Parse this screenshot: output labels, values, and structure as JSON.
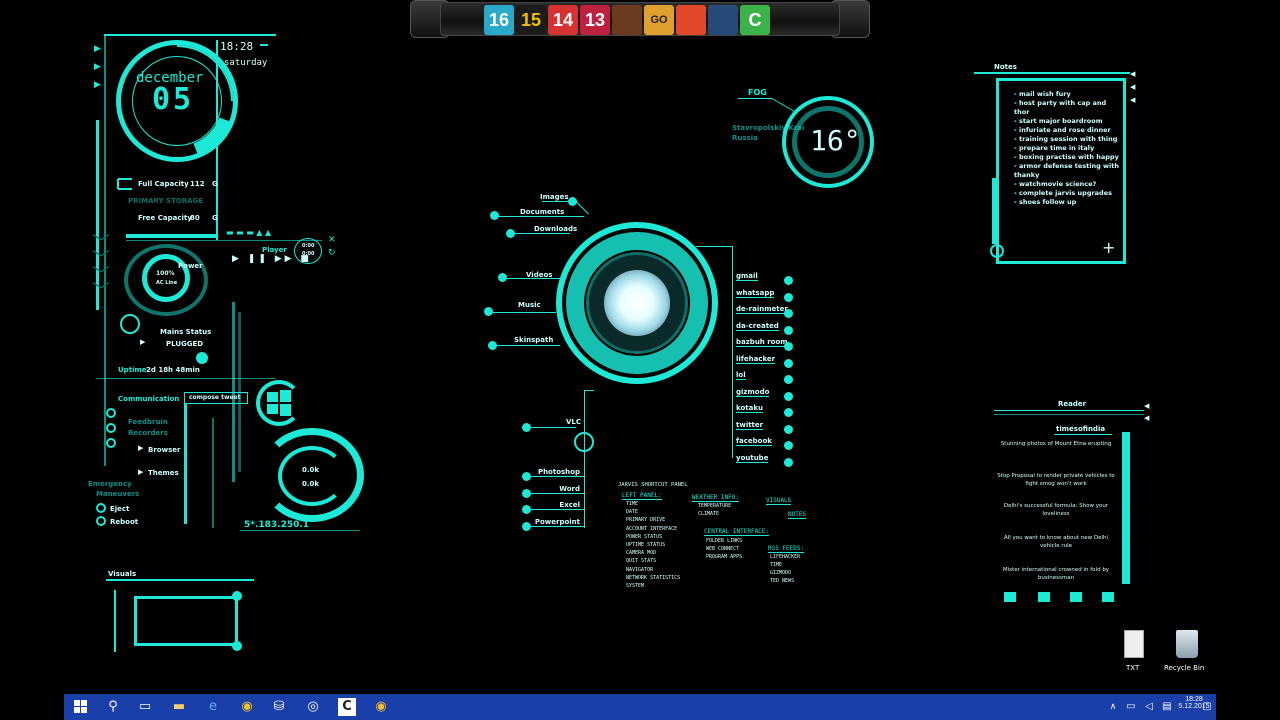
{
  "dock": {
    "icons": [
      {
        "label": "16",
        "name": "dock-icon-16",
        "bg": "#2aa8c8",
        "fg": "#fff"
      },
      {
        "label": "15",
        "name": "dock-icon-15",
        "bg": "#1b1b1b",
        "fg": "#f0c000"
      },
      {
        "label": "14",
        "name": "dock-icon-14",
        "bg": "#d63232",
        "fg": "#fff"
      },
      {
        "label": "13",
        "name": "dock-icon-13",
        "bg": "#c02040",
        "fg": "#fff"
      },
      {
        "label": "",
        "name": "dock-icon-app",
        "bg": "#6b3b1e",
        "fg": "#fff"
      },
      {
        "label": "GO",
        "name": "dock-icon-csgo",
        "bg": "#e0a030",
        "fg": "#222"
      },
      {
        "label": "",
        "name": "dock-icon-origin",
        "bg": "#e04a2a",
        "fg": "#fff"
      },
      {
        "label": "",
        "name": "dock-icon-steam",
        "bg": "#274a78",
        "fg": "#fff"
      },
      {
        "label": "C",
        "name": "dock-icon-camtasia",
        "bg": "#3bb34a",
        "fg": "#fff"
      }
    ]
  },
  "clock": {
    "month": "december",
    "day": "05",
    "time": "18:28",
    "weekday": "saturday"
  },
  "drive": {
    "full_label": "Full Capacity",
    "full_value": "112",
    "full_unit": "G",
    "status_label": "PRIMARY STORAGE",
    "free_label": "Free Capacity",
    "free_value": "80",
    "free_unit": "G"
  },
  "player": {
    "label": "Player",
    "time_a": "0:00",
    "time_b": "0:00"
  },
  "power": {
    "label": "Power",
    "percent": "100%",
    "sub": "AC Line",
    "status_label": "Mains Status",
    "status_value": "PLUGGED"
  },
  "uptime": {
    "label": "Uptime",
    "value": "2d 18h 48min"
  },
  "communication": {
    "label": "Communication",
    "compose": "compose tweet",
    "items": [
      "Feedbruin",
      "Recorders"
    ],
    "browser": "Browser",
    "themes": "Themes"
  },
  "emergency": {
    "label1": "Emergency",
    "label2": "Maneuvers",
    "eject": "Eject",
    "reboot": "Reboot"
  },
  "network": {
    "up": "0.0k",
    "down": "0.0k",
    "ip": "5*.183.250.1"
  },
  "visuals_left": {
    "label": "Visuals"
  },
  "weather": {
    "label": "FOG",
    "location": "Stavropolskiy Krai",
    "country": "Russia",
    "temp": "16°"
  },
  "arc": {
    "left_items": [
      "Images",
      "Documents",
      "Downloads",
      "Videos",
      "Music",
      "Skinspath"
    ],
    "right_items": [
      "gmail",
      "whatsapp",
      "de-rainmeter",
      "da-created",
      "bazbuh room",
      "lifehacker",
      "lol",
      "gizmodo",
      "kotaku",
      "twitter",
      "facebook",
      "youtube"
    ],
    "mid_label": "VLC",
    "lower_items": [
      "Photoshop",
      "Word",
      "Excel",
      "Powerpoint"
    ]
  },
  "help": {
    "title": "JARVIS SHORTCUT PANEL",
    "left_panel": "LEFT PANEL:",
    "left_items": [
      "TIME",
      "DATE",
      "PRIMARY DRIVE",
      "ACCOUNT INTERFACE",
      "POWER STATUS",
      "UPTIME STATUS",
      "CAMERA MOD",
      "QUIT STATS",
      "NAVIGATOR",
      "NETWORK STATISTICS",
      "SYSTEM"
    ],
    "weather_label": "WEATHER INFO:",
    "weather_items": [
      "TEMPERATURE",
      "CLIMATE"
    ],
    "visuals_label": "VISUALS",
    "notes_label": "NOTES",
    "central_label": "CENTRAL INTERFACE:",
    "central_items": [
      "FOLDER LINKS",
      "WEB CONNECT",
      "PROGRAM APPS"
    ],
    "right_panel": "RSS FEEDS:",
    "right_items": [
      "LIFEHACKER",
      "TIME",
      "GIZMODO",
      "TED NEWS"
    ]
  },
  "notes": {
    "label": "Notes",
    "lines": [
      "- mail wish fury",
      "- host party with cap and",
      "thor",
      "- start major boardroom",
      "- infuriate and rose dinner",
      "- training session with thing",
      "- prepare time in italy",
      "- boxing practise with happy",
      "- armor defense testing with",
      "thanky",
      "- watchmovie science?",
      "- complete jarvis upgrades",
      "- shoes follow up"
    ]
  },
  "reader": {
    "label": "Reader",
    "source": "timesofindia",
    "items": [
      "Stunning photos of Mount Etna erupting",
      "Stop Proposal to render private vehicles to fight smog won't work",
      "Delhi's successful formula: Show your loveliness",
      "All you want to know about new Delhi vehicle rule",
      "Mister international crowned in fold by businessman"
    ]
  },
  "desktop_icons": [
    {
      "label": "TXT",
      "name": "txt-file-icon"
    },
    {
      "label": "Recycle Bin",
      "name": "recycle-bin-icon"
    }
  ],
  "taskbar": {
    "time": "18:28",
    "date": "5.12.2015"
  }
}
